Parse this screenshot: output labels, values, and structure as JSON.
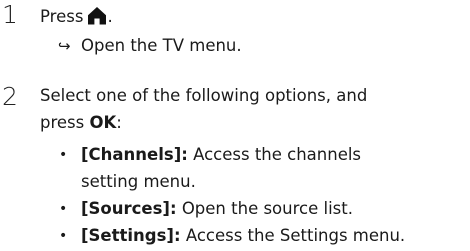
{
  "steps": [
    {
      "number": "1",
      "text_before_icon": "Press",
      "icon": "home-icon",
      "text_after_icon": ".",
      "result_arrow": "↪",
      "result": "Open the TV menu."
    },
    {
      "number": "2",
      "line1": "Select one of the following options, and",
      "line2_prefix": "press ",
      "line2_bold": "OK",
      "line2_suffix": ":",
      "bullet_glyph": "•",
      "options": [
        {
          "label": "[Channels]:",
          "desc_line1": " Access the channels",
          "desc_line2": "setting menu."
        },
        {
          "label": "[Sources]:",
          "desc_line1": " Open the source list."
        },
        {
          "label": "[Settings]:",
          "desc_line1": " Access the Settings menu."
        }
      ]
    }
  ]
}
